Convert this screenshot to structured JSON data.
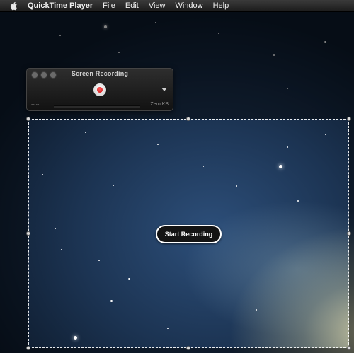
{
  "menubar": {
    "apple_icon": "apple-icon",
    "app_name": "QuickTime Player",
    "items": [
      "File",
      "Edit",
      "View",
      "Window",
      "Help"
    ]
  },
  "panel": {
    "title": "Screen Recording",
    "time": "--:--",
    "file_size": "Zero KB",
    "record_icon": "record-icon",
    "options_icon": "triangle-down-icon"
  },
  "selection": {
    "start_button_label": "Start Recording"
  },
  "colors": {
    "record_red": "#d21a1a",
    "menubar_bg": "#2a2a2a",
    "panel_bg": "#1e1e1e"
  }
}
